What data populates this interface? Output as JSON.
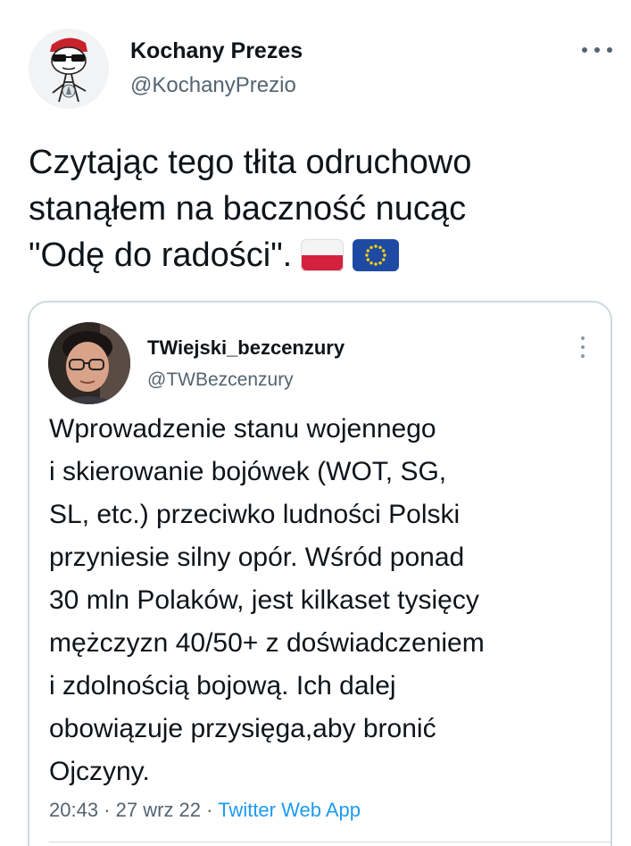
{
  "tweet": {
    "author_name": "Kochany Prezes",
    "author_handle": "@KochanyPrezio",
    "avatar_icon": "cartoon-avatar-icon",
    "more_icon": "more-horizontal-icon",
    "text_lines": [
      "Czytając tego tłita odruchowo",
      "stanąłem na baczność nucąc",
      "\"Odę do radości\"."
    ],
    "emoji": [
      "poland-flag-icon",
      "eu-flag-icon"
    ]
  },
  "quoted_tweet": {
    "author_name": "TWiejski_bezcenzury",
    "author_handle": "@TWBezcenzury",
    "avatar_icon": "profile-photo-avatar",
    "more_icon": "more-vertical-icon",
    "text_lines": [
      "Wprowadzenie stanu wojennego",
      "i skierowanie bojówek (WOT, SG,",
      "SL, etc.) przeciwko ludności Polski",
      "przyniesie silny opór. Wśród ponad",
      "30 mln Polaków, jest kilkaset tysięcy",
      "mężczyzn 40/50+ z doświadczeniem",
      "i zdolnością bojową. Ich dalej",
      "obowiązuje przysięga,aby bronić",
      "Ojczyny."
    ],
    "time": "20:43",
    "separator": "·",
    "date": "27 wrz 22",
    "source": "Twitter Web App"
  },
  "colors": {
    "text": "#0f1419",
    "secondary": "#536471",
    "link": "#1d9bf0",
    "border": "#cfd9de"
  }
}
